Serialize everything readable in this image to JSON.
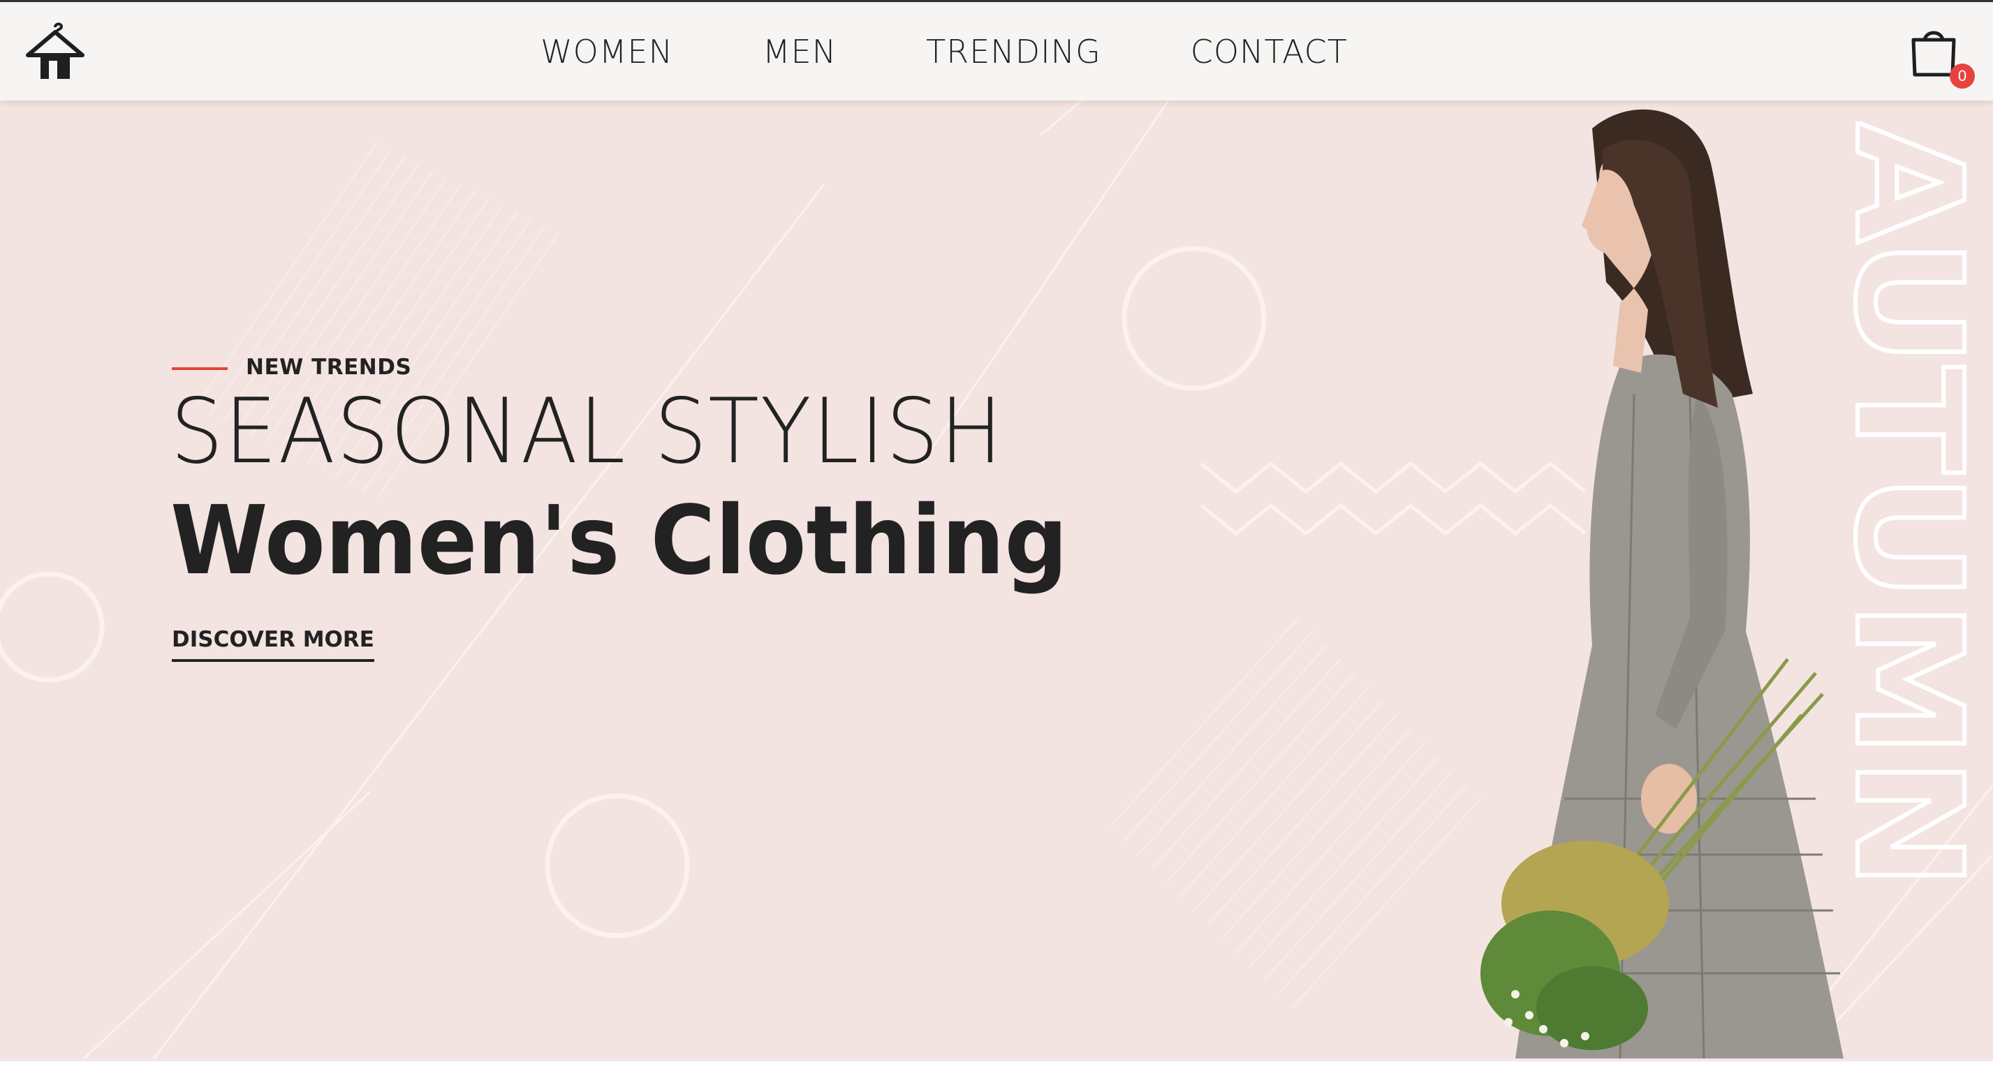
{
  "header": {
    "nav": [
      "WOMEN",
      "MEN",
      "TRENDING",
      "CONTACT"
    ],
    "cart_count": "0"
  },
  "hero": {
    "eyebrow": "NEW TRENDS",
    "title_line1": "SEASONAL STYLISH",
    "title_line2": "Women's Clothing",
    "cta": "DISCOVER MORE",
    "vertical_word": "AUTUMN",
    "image": "woman in grey linen dress holding a bouquet of dried grasses"
  },
  "colors": {
    "hero_bg": "#f3e4e1",
    "header_bg": "#f6f5f3",
    "accent": "#e8423f",
    "text": "#222222"
  },
  "icons": [
    "hanger-house-logo-icon",
    "shopping-bag-icon"
  ]
}
